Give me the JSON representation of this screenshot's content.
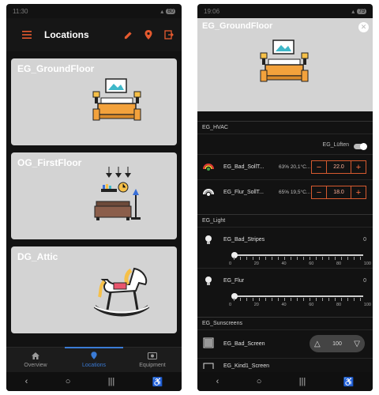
{
  "left": {
    "status": {
      "time": "11:30",
      "battery": "80"
    },
    "appbar": {
      "title": "Locations"
    },
    "cards": [
      {
        "label": "EG_GroundFloor"
      },
      {
        "label": "OG_FirstFloor"
      },
      {
        "label": "DG_Attic"
      }
    ],
    "nav": [
      {
        "label": "Overview"
      },
      {
        "label": "Locations"
      },
      {
        "label": "Equipment"
      }
    ]
  },
  "right": {
    "status": {
      "time": "19:06",
      "battery": "79"
    },
    "header": {
      "title": "EG_GroundFloor"
    },
    "sections": {
      "hvac": "EG_HVAC",
      "light": "EG_Light",
      "sun": "EG_Sunscreens"
    },
    "hvac": {
      "toggle_label": "EG_Lüften",
      "items": [
        {
          "name": "EG_Bad_SollT...",
          "meta": "63% 20,1°C...",
          "value": "22.0"
        },
        {
          "name": "EG_Flur_SollT...",
          "meta": "65% 19,5°C...",
          "value": "18.0"
        }
      ]
    },
    "light": {
      "items": [
        {
          "name": "EG_Bad_Stripes",
          "value": "0"
        },
        {
          "name": "EG_Flur",
          "value": "0"
        }
      ],
      "ticks": [
        "0",
        "20",
        "40",
        "60",
        "80",
        "100"
      ]
    },
    "sun": {
      "items": [
        {
          "name": "EG_Bad_Screen",
          "value": "100"
        },
        {
          "name": "EG_Kind1_Screen"
        }
      ]
    }
  },
  "colors": {
    "accent": "#e65a2f",
    "nav_active": "#3a7bd5",
    "card_bg": "#d3d3d3"
  }
}
